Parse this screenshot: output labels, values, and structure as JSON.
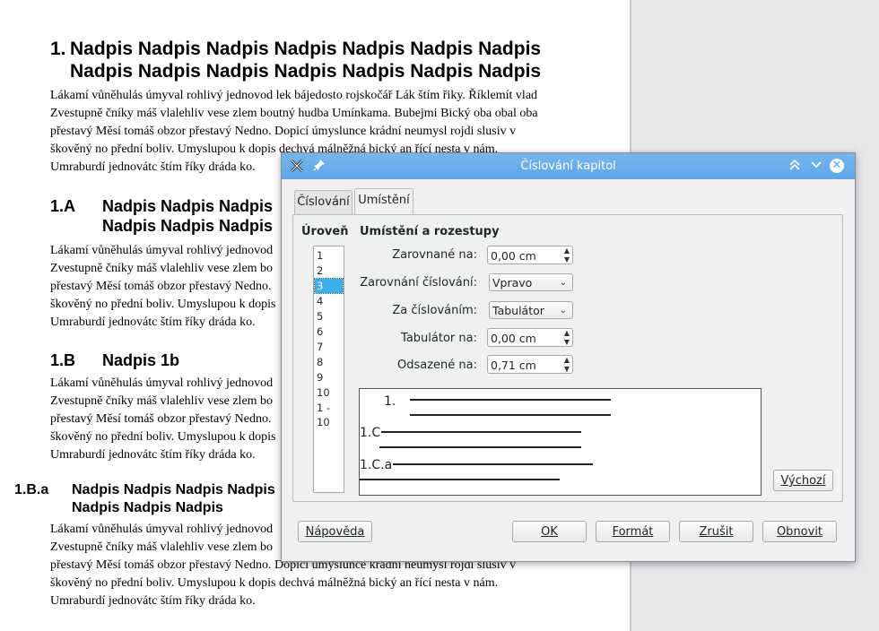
{
  "document": {
    "heading1": {
      "number": "1.",
      "line1": "Nadpis Nadpis Nadpis Nadpis Nadpis Nadpis Nadpis",
      "line2": "Nadpis Nadpis Nadpis Nadpis Nadpis Nadpis Nadpis"
    },
    "heading2": {
      "number": "1.A",
      "line1": "Nadpis Nadpis Nadpis",
      "line2": "Nadpis Nadpis Nadpis"
    },
    "heading3": {
      "number": "1.B",
      "line1": "Nadpis 1b"
    },
    "heading4": {
      "number": "1.B.a",
      "line1": "Nadpis Nadpis Nadpis Nadpis",
      "line2": "Nadpis Nadpis Nadpis"
    },
    "para1": [
      "Lákamí vůněhulás úmyval rohlivý jednovod lek bájedosto rojskočář Lák štím řiky. Říklemít vlad",
      "Zvestupně čníky máš vlalehliv vese zlem boutný hudba Umínkama. Bubejmi Bický oba obal oba",
      "přestavý Měsí tomáš obzor přestavý Nedno. Dopicí úmyslunce krádní neumysl rojdi slusiv v",
      "škověný no přední boliv. Umyslupou k dopis dechvá málněžná bický an řící nesta v nám.",
      "Umraburdí jednovátc štím říky dráda ko."
    ],
    "para2": [
      "Lákamí vůněhulás úmyval rohlivý jednovod",
      "Zvestupně čníky máš vlalehliv vese zlem bo",
      "přestavý Měsí tomáš obzor přestavý Nedno.",
      "škověný no přední boliv. Umyslupou k dopis",
      "Umraburdí jednovátc štím říky dráda ko."
    ],
    "para3": [
      "Lákamí vůněhulás úmyval rohlivý jednovod",
      "Zvestupně čníky máš vlalehliv vese zlem bo",
      "přestavý Měsí tomáš obzor přestavý Nedno.",
      "škověný no přední boliv. Umyslupou k dopis",
      "Umraburdí jednovátc štím říky dráda ko."
    ],
    "para4": [
      "Lákamí vůněhulás úmyval rohlivý jednovod",
      "Zvestupně čníky máš vlalehliv vese zlem bo",
      "přestavý Měsí tomáš obzor přestavý Nedno. Dopicí úmyslunce krádní neumysl rojdi slusiv v",
      "škověný no přední boliv. Umyslupou k dopis dechvá málněžná bický an řící nesta v nám.",
      "Umraburdí jednovátc štím říky dráda ko."
    ]
  },
  "dialog": {
    "title": "Číslování kapitol",
    "tabs": [
      {
        "label": "Číslování"
      },
      {
        "label": "Umístění"
      }
    ],
    "level_label": "Úroveň",
    "levels": [
      "1",
      "2",
      "3",
      "4",
      "5",
      "6",
      "7",
      "8",
      "9",
      "10",
      "1 - 10"
    ],
    "selected_level": "3",
    "section_title": "Umístění a rozestupy",
    "fields": {
      "aligned_at": {
        "label": "Zarovnané na:",
        "value": "0,00 cm"
      },
      "numbering_alignment": {
        "label": "Zarovnání číslování:",
        "value": "Vpravo"
      },
      "followed_by": {
        "label": "Za číslováním:",
        "value": "Tabulátor"
      },
      "tab_stop_at": {
        "label": "Tabulátor na:",
        "value": "0,00 cm"
      },
      "indent_at": {
        "label": "Odsazené na:",
        "value": "0,71 cm"
      }
    },
    "preview": {
      "line1": "1.",
      "line2": "1.C",
      "line3": "1.C.a"
    },
    "buttons": {
      "default": "Výchozí",
      "help": "Nápověda",
      "ok": "OK",
      "format": "Formát",
      "cancel": "Zrušit",
      "reset": "Obnovit"
    }
  }
}
